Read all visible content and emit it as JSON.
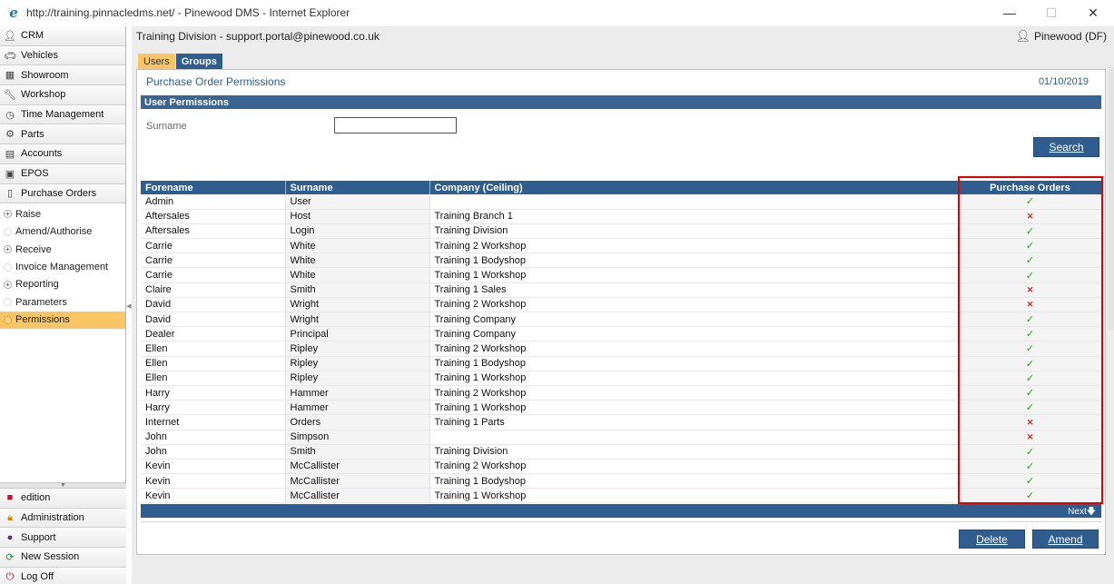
{
  "window": {
    "title": "http://training.pinnacledms.net/ - Pinewood DMS - Internet Explorer",
    "minimize": "—",
    "maximize": "☐",
    "close": "✕"
  },
  "header": {
    "division": "Training Division - support.portal@pinewood.co.uk",
    "user": "Pinewood (DF)"
  },
  "sidebar": {
    "modules": [
      {
        "label": "CRM",
        "icon": "person-icon"
      },
      {
        "label": "Vehicles",
        "icon": "car-icon"
      },
      {
        "label": "Showroom",
        "icon": "showroom-icon"
      },
      {
        "label": "Workshop",
        "icon": "wrench-icon"
      },
      {
        "label": "Time Management",
        "icon": "clock-icon"
      },
      {
        "label": "Parts",
        "icon": "gears-icon"
      },
      {
        "label": "Accounts",
        "icon": "ledger-icon"
      },
      {
        "label": "EPOS",
        "icon": "till-icon"
      },
      {
        "label": "Purchase Orders",
        "icon": "document-icon"
      }
    ],
    "sub_items": [
      {
        "label": "Raise",
        "expandable": true
      },
      {
        "label": "Amend/Authorise",
        "expandable": false
      },
      {
        "label": "Receive",
        "expandable": true
      },
      {
        "label": "Invoice Management",
        "expandable": false
      },
      {
        "label": "Reporting",
        "expandable": true
      },
      {
        "label": "Parameters",
        "expandable": false
      },
      {
        "label": "Permissions",
        "expandable": false,
        "active": true
      }
    ],
    "bottom": [
      {
        "label": "edition",
        "icon": "book-icon",
        "color": "#c8102e"
      },
      {
        "label": "Administration",
        "icon": "lock-icon",
        "color": "#d08a00"
      },
      {
        "label": "Support",
        "icon": "support-icon",
        "color": "#5a2d82"
      },
      {
        "label": "New Session",
        "icon": "refresh-icon",
        "color": "#1e8e3e"
      },
      {
        "label": "Log Off",
        "icon": "power-icon",
        "color": "#c8102e"
      }
    ]
  },
  "tabs": {
    "users": "Users",
    "groups": "Groups"
  },
  "page": {
    "title": "Purchase Order Permissions",
    "date": "01/10/2019",
    "section": "User Permissions",
    "surname_label": "Surname",
    "surname_value": "",
    "search_label": "Search",
    "delete_label": "Delete",
    "amend_label": "Amend",
    "next_label": "Next"
  },
  "table": {
    "columns": [
      "Forename",
      "Surname",
      "Company (Ceiling)",
      "Purchase Orders"
    ],
    "rows": [
      [
        "Admin",
        "User",
        "",
        true
      ],
      [
        "Aftersales",
        "Host",
        "Training Branch 1",
        false
      ],
      [
        "Aftersales",
        "Login",
        "Training Division",
        true
      ],
      [
        "Carrie",
        "White",
        "Training 2 Workshop",
        true
      ],
      [
        "Carrie",
        "White",
        "Training 1 Bodyshop",
        true
      ],
      [
        "Carrie",
        "White",
        "Training 1 Workshop",
        true
      ],
      [
        "Claire",
        "Smith",
        "Training 1 Sales",
        false
      ],
      [
        "David",
        "Wright",
        "Training 2 Workshop",
        false
      ],
      [
        "David",
        "Wright",
        "Training Company",
        true
      ],
      [
        "Dealer",
        "Principal",
        "Training Company",
        true
      ],
      [
        "Ellen",
        "Ripley",
        "Training 2 Workshop",
        true
      ],
      [
        "Ellen",
        "Ripley",
        "Training 1 Bodyshop",
        true
      ],
      [
        "Ellen",
        "Ripley",
        "Training 1 Workshop",
        true
      ],
      [
        "Harry",
        "Hammer",
        "Training 2 Workshop",
        true
      ],
      [
        "Harry",
        "Hammer",
        "Training 1 Workshop",
        true
      ],
      [
        "Internet",
        "Orders",
        "Training 1 Parts",
        false
      ],
      [
        "John",
        "Simpson",
        "",
        false
      ],
      [
        "John",
        "Smith",
        "Training Division",
        true
      ],
      [
        "Kevin",
        "McCallister",
        "Training 2 Workshop",
        true
      ],
      [
        "Kevin",
        "McCallister",
        "Training 1 Bodyshop",
        true
      ],
      [
        "Kevin",
        "McCallister",
        "Training 1 Workshop",
        true
      ]
    ]
  },
  "colors": {
    "accent": "#2f5d8f",
    "active": "#f9c565",
    "highlight": "#e00000"
  }
}
